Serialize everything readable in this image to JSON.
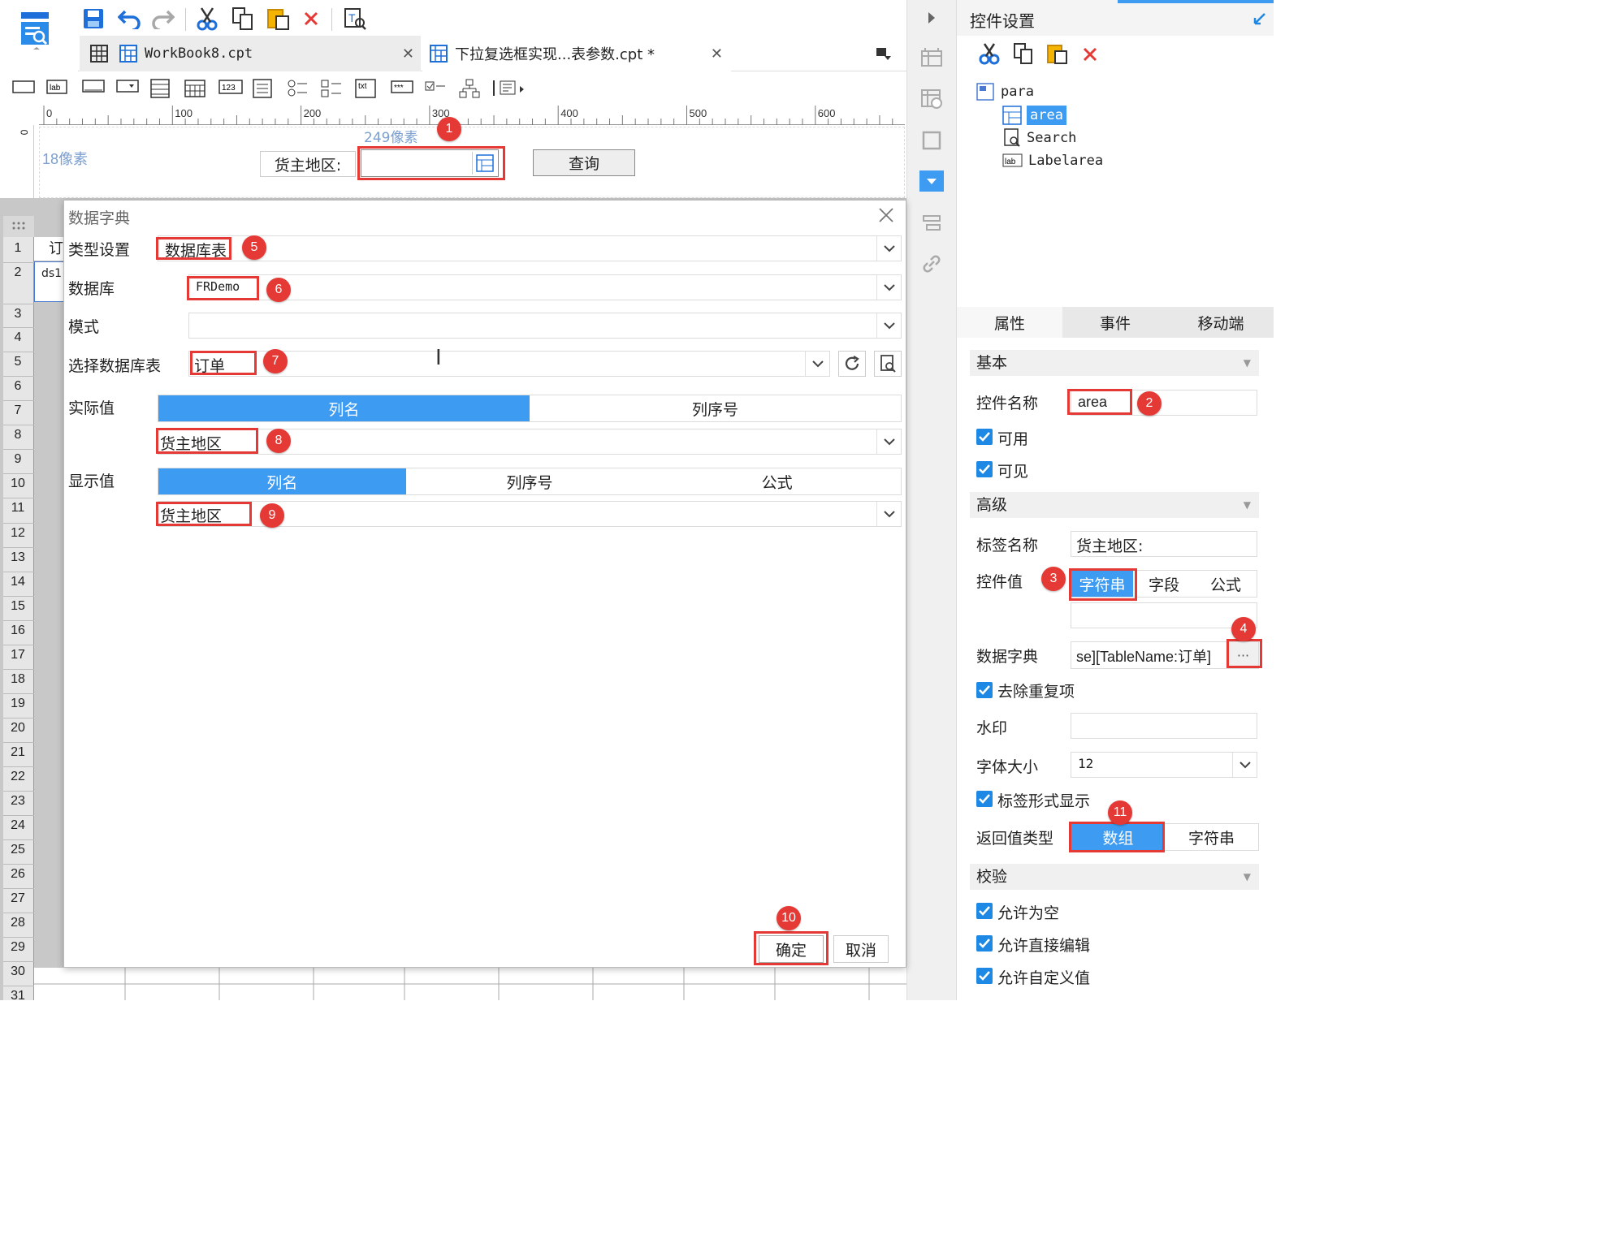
{
  "tabs": [
    {
      "label": "WorkBook8.cpt"
    },
    {
      "label": "下拉复选框实现...表参数.cpt *"
    }
  ],
  "ruler": {
    "ticks": [
      "0",
      "100",
      "200",
      "300",
      "400",
      "500",
      "600"
    ],
    "left_zero": "0",
    "width_hint": "249像素",
    "height_hint": "18像素"
  },
  "param": {
    "label": "货主地区:",
    "query_button": "查询"
  },
  "grid": {
    "rows": [
      "1",
      "2",
      "3",
      "4",
      "5",
      "6",
      "7",
      "8",
      "9",
      "10",
      "11",
      "12",
      "13",
      "14",
      "15",
      "16",
      "17",
      "18",
      "19",
      "20",
      "21",
      "22",
      "23",
      "24",
      "25",
      "26",
      "27",
      "28",
      "29",
      "30",
      "31"
    ],
    "cell_a1": "订",
    "cell_a2": "ds1"
  },
  "dialog": {
    "title": "数据字典",
    "type_label": "类型设置",
    "type_value": "数据库表",
    "db_label": "数据库",
    "db_value": "FRDemo",
    "mode_label": "模式",
    "mode_value": "",
    "table_label": "选择数据库表",
    "table_value": "订单",
    "actual_label": "实际值",
    "actual_tabs": [
      "列名",
      "列序号"
    ],
    "actual_value": "货主地区",
    "display_label": "显示值",
    "display_tabs": [
      "列名",
      "列序号",
      "公式"
    ],
    "display_value": "货主地区",
    "ok": "确定",
    "cancel": "取消"
  },
  "panel": {
    "title": "控件设置",
    "tree": {
      "root": "para",
      "items": [
        "area",
        "Search",
        "Labelarea"
      ]
    },
    "tabs": [
      "属性",
      "事件",
      "移动端"
    ],
    "basic": "基本",
    "name_label": "控件名称",
    "name_value": "area",
    "enabled": "可用",
    "visible": "可见",
    "advanced": "高级",
    "label_name_label": "标签名称",
    "label_name_value": "货主地区:",
    "value_label": "控件值",
    "value_tabs": [
      "字符串",
      "字段",
      "公式"
    ],
    "value_input": "",
    "dict_label": "数据字典",
    "dict_value": "se][TableName:订单]",
    "dict_button": "···",
    "dedupe": "去除重复项",
    "watermark_label": "水印",
    "watermark_value": "",
    "font_size_label": "字体大小",
    "font_size_value": "12",
    "label_show": "标签形式显示",
    "return_type_label": "返回值类型",
    "return_tabs": [
      "数组",
      "字符串"
    ],
    "validate": "校验",
    "allow_empty": "允许为空",
    "allow_edit": "允许直接编辑",
    "allow_custom": "允许自定义值"
  },
  "badges": [
    "1",
    "2",
    "3",
    "4",
    "5",
    "6",
    "7",
    "8",
    "9",
    "10",
    "11"
  ],
  "colors": {
    "accent": "#3d9bf2",
    "highlight": "#e53935",
    "check": "#1e88e5"
  }
}
